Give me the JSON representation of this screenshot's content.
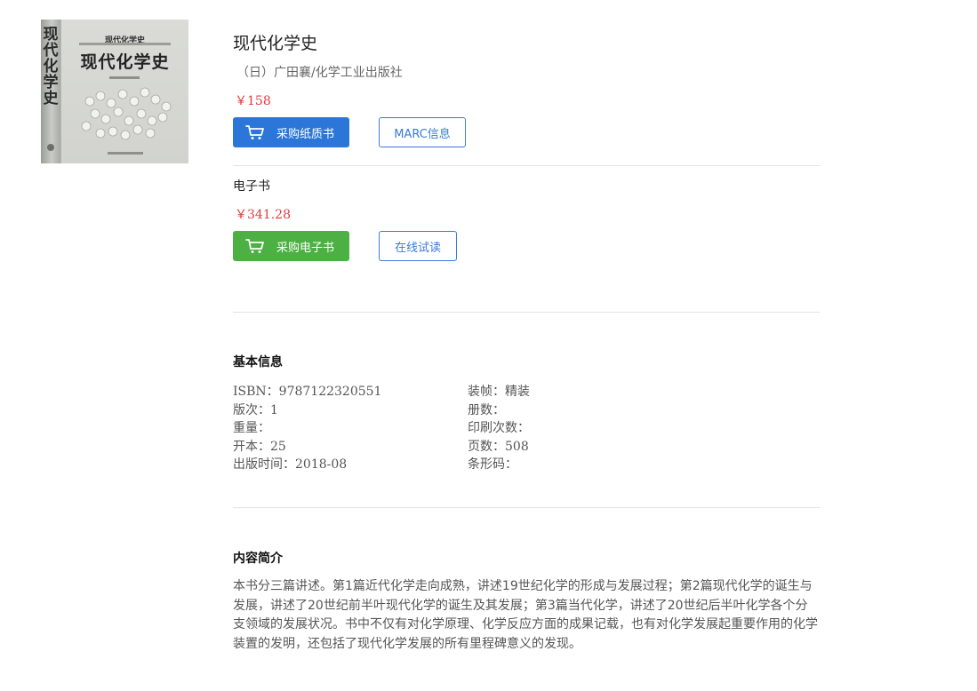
{
  "book": {
    "title": "现代化学史",
    "publisher_line": "（日）广田襄/化学工业出版社",
    "paper_price": "￥158",
    "cover": {
      "spine_text": [
        "现",
        "代",
        "化",
        "学",
        "史"
      ],
      "small_title": "现代化学史",
      "big_title": "现代化学史"
    }
  },
  "actions": {
    "buy_paper": "采购纸质书",
    "marc": "MARC信息",
    "buy_ebook": "采购电子书",
    "read_online": "在线试读"
  },
  "ebook": {
    "label": "电子书",
    "price": "￥341.28"
  },
  "basic_info": {
    "heading": "基本信息",
    "left": [
      "ISBN：9787122320551",
      "版次：1",
      "重量：",
      "开本：25",
      "出版时间：2018-08"
    ],
    "right": [
      "装帧：精装",
      "册数：",
      "印刷次数：",
      "页数：508",
      "条形码："
    ]
  },
  "intro": {
    "heading": "内容简介",
    "text": "本书分三篇讲述。第1篇近代化学走向成熟，讲述19世纪化学的形成与发展过程；第2篇现代化学的诞生与发展，讲述了20世纪前半叶现代化学的诞生及其发展；第3篇当代化学，讲述了20世纪后半叶化学各个分支领域的发展状况。书中不仅有对化学原理、化学反应方面的成果记载，也有对化学发展起重要作用的化学装置的发明，还包括了现代化学发展的所有里程碑意义的发现。"
  },
  "colors": {
    "primary_blue": "#2d76d9",
    "ebook_green": "#4cb043",
    "price_red": "#e4393c"
  },
  "icons": [
    "cart-icon"
  ]
}
